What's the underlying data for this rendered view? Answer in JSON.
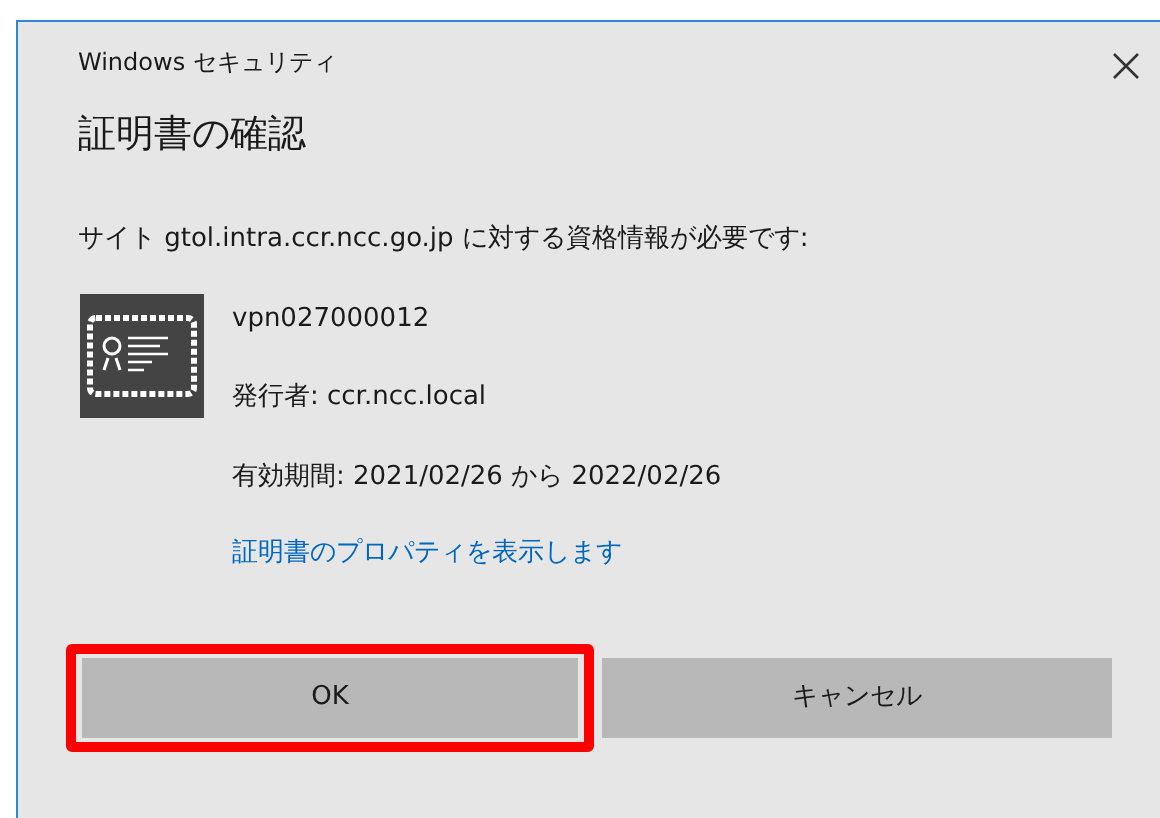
{
  "window": {
    "title": "Windows セキュリティ"
  },
  "heading": "証明書の確認",
  "message": "サイト gtol.intra.ccr.ncc.go.jp に対する資格情報が必要です:",
  "certificate": {
    "name": "vpn027000012",
    "issuer": "発行者: ccr.ncc.local",
    "validity": "有効期間: 2021/02/26 から 2022/02/26",
    "link": "証明書のプロパティを表示します"
  },
  "buttons": [
    {
      "label": "OK",
      "highlighted": true
    },
    {
      "label": "キャンセル",
      "highlighted": false
    }
  ]
}
